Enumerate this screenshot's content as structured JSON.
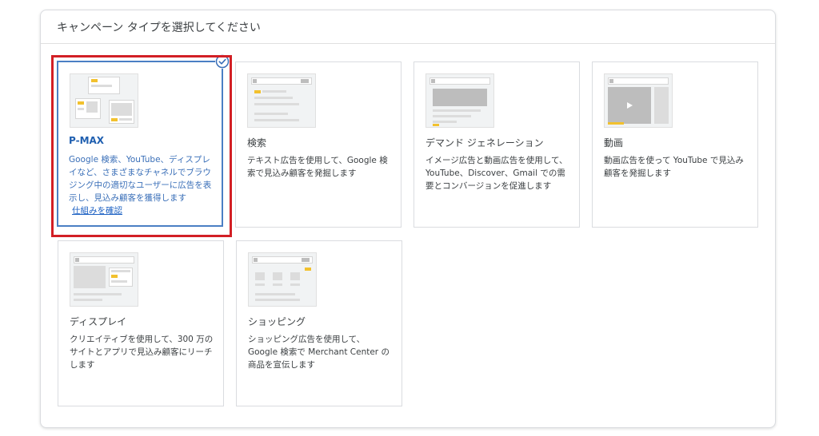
{
  "panel": {
    "title": "キャンペーン タイプを選択してください"
  },
  "cards": [
    {
      "id": "pmax",
      "title": "P-MAX",
      "description": "Google 検索、YouTube、ディスプレイなど、さまざまなチャネルでブラウジング中の適切なユーザーに広告を表示し、見込み顧客を獲得します",
      "link": "仕組みを確認",
      "selected": true
    },
    {
      "id": "search",
      "title": "検索",
      "description": "テキスト広告を使用して、Google 検索で見込み顧客を発掘します",
      "selected": false
    },
    {
      "id": "demand-gen",
      "title": "デマンド ジェネレーション",
      "description": "イメージ広告と動画広告を使用して、YouTube、Discover、Gmail での需要とコンバージョンを促進します",
      "selected": false
    },
    {
      "id": "video",
      "title": "動画",
      "description": "動画広告を使って YouTube で見込み顧客を発掘します",
      "selected": false
    },
    {
      "id": "display",
      "title": "ディスプレイ",
      "description": "クリエイティブを使用して、300 万のサイトとアプリで見込み顧客にリーチします",
      "selected": false
    },
    {
      "id": "shopping",
      "title": "ショッピング",
      "description": "ショッピング広告を使用して、Google 検索で Merchant Center の商品を宣伝します",
      "selected": false
    }
  ],
  "icons": {
    "selected_check": "check-circle-icon",
    "video_play": "play-icon"
  },
  "colors": {
    "accent": "#1a73e8",
    "selected_border": "#4a7fc4",
    "highlight_frame": "#d21f25",
    "thumb_accent": "#f2c12e"
  }
}
